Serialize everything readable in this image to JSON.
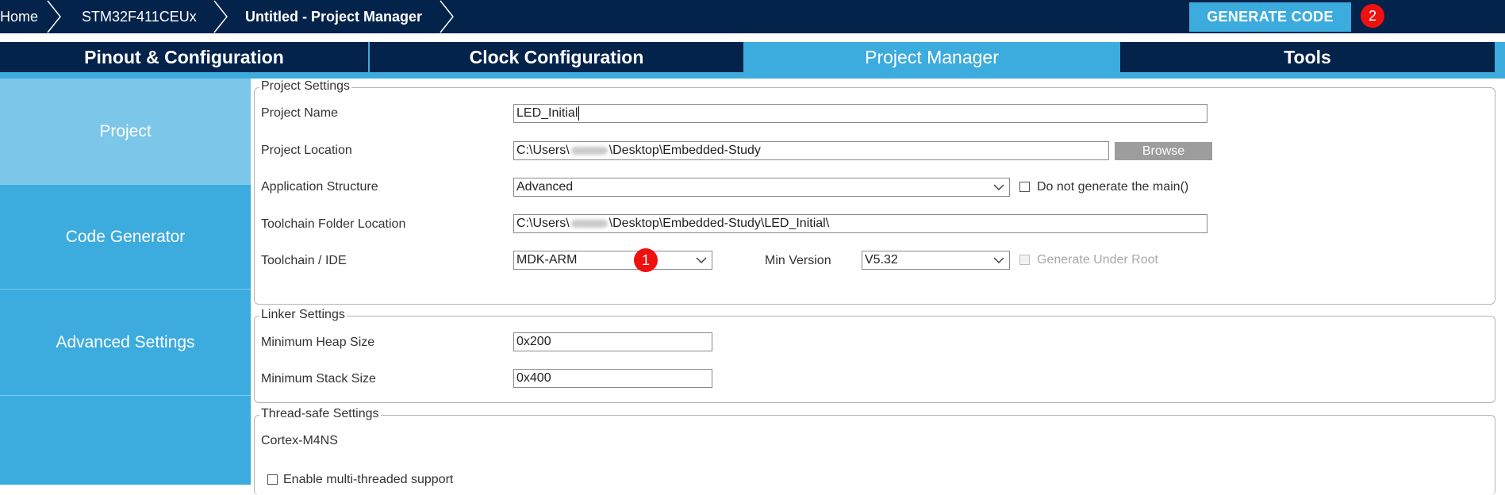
{
  "breadcrumb": {
    "home": "Home",
    "device": "STM32F411CEUx",
    "project": "Untitled - Project Manager"
  },
  "generate_button": "GENERATE CODE",
  "badges": {
    "generate": "2",
    "toolchain": "1"
  },
  "tabs": [
    {
      "label": "Pinout & Configuration"
    },
    {
      "label": "Clock Configuration"
    },
    {
      "label": "Project Manager"
    },
    {
      "label": "Tools"
    }
  ],
  "sidebar": {
    "items": [
      {
        "label": "Project"
      },
      {
        "label": "Code Generator"
      },
      {
        "label": "Advanced Settings"
      }
    ]
  },
  "project_settings": {
    "legend": "Project Settings",
    "project_name_label": "Project Name",
    "project_name_value": "LED_Initial",
    "project_location_label": "Project Location",
    "project_location_prefix": "C:\\Users\\",
    "project_location_suffix": "\\Desktop\\Embedded-Study",
    "browse_label": "Browse",
    "app_structure_label": "Application Structure",
    "app_structure_value": "Advanced",
    "no_main_label": "Do not generate the main()",
    "toolchain_folder_label": "Toolchain Folder Location",
    "toolchain_folder_prefix": "C:\\Users\\",
    "toolchain_folder_suffix": "\\Desktop\\Embedded-Study\\LED_Initial\\",
    "toolchain_ide_label": "Toolchain / IDE",
    "toolchain_ide_value": "MDK-ARM",
    "min_version_label": "Min Version",
    "min_version_value": "V5.32",
    "generate_under_root_label": "Generate Under Root"
  },
  "linker_settings": {
    "legend": "Linker Settings",
    "heap_label": "Minimum Heap Size",
    "heap_value": "0x200",
    "stack_label": "Minimum Stack Size",
    "stack_value": "0x400"
  },
  "thread_safe_settings": {
    "legend": "Thread-safe Settings",
    "core": "Cortex-M4NS",
    "multithread_label": "Enable multi-threaded support"
  },
  "colors": {
    "navy": "#03234b",
    "accent": "#3cabde",
    "sidebar_active": "#7cc6ea",
    "badge_red": "#ef1010"
  }
}
